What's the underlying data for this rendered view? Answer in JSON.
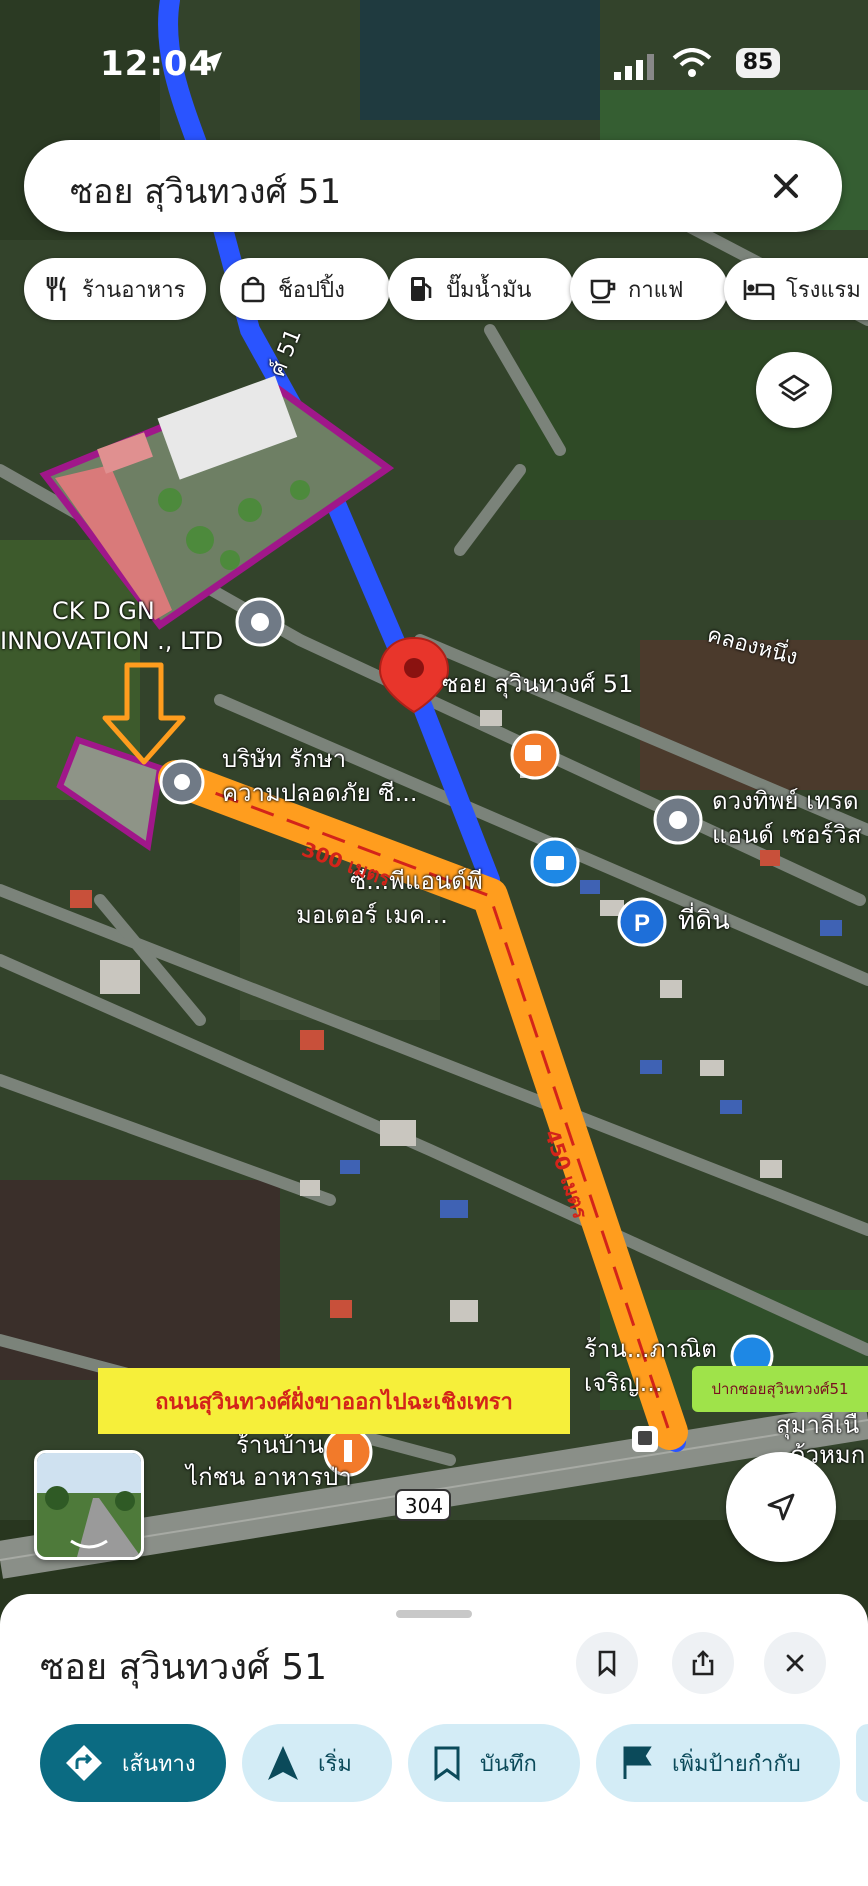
{
  "status_bar": {
    "time": "12:04",
    "battery": "85"
  },
  "search": {
    "query": "ซอย สุวินทวงศ์ 51"
  },
  "categories": [
    {
      "label": "ร้านอาหาร",
      "icon": "fork-knife-icon"
    },
    {
      "label": "ช็อปปิ้ง",
      "icon": "shopping-bag-icon"
    },
    {
      "label": "ปั๊มน้ำมัน",
      "icon": "gas-pump-icon"
    },
    {
      "label": "กาแฟ",
      "icon": "coffee-cup-icon"
    },
    {
      "label": "โรงแรม",
      "icon": "bed-icon"
    }
  ],
  "map": {
    "labels": {
      "road_vertical": "ซอย สุวินทวงศ์ 51",
      "road_51": "ศ์ 51",
      "company_1": "CK D     GN",
      "company_2": "INNOVATION ., LTD",
      "canal": "คลองหนึ่ง",
      "security_1": "บริษัท รักษา",
      "security_2": "ความปลอดภัย ซี...",
      "pp_1": "ซี...พีแอนด์พี",
      "pp_2": "มอเตอร์ เมค...",
      "duangthip_1": "ดวงทิพย์ เทรด",
      "duangthip_2": "แอนด์ เซอร์วิส",
      "land": "ที่ดิน",
      "shop_1": "ร้าน...ภาณิต",
      "shop_2": "เจริญ...",
      "food_1": "ร้านบ้าน",
      "food_2": "ไก่ชน อาหารป่า",
      "right_edge_1": "สุมาลีเนื",
      "right_edge_2": "ด้วหมก",
      "highway": "304"
    },
    "pin_label": "ซอย สุวินทวงศ์ 51",
    "annotations": {
      "distance_1": "300 เมตร",
      "distance_2": "450 เมตร",
      "banner_main": "ถนนสุวินทวงศ์ฝั่งขาออกไปฉะเชิงเทรา",
      "banner_soi": "ปากซอยสุวินทวงศ์51"
    },
    "colors": {
      "route": "#1f4fff",
      "annotation": "#ff9d1e",
      "highlight": "#a0178a"
    }
  },
  "place_sheet": {
    "title": "ซอย สุวินทวงศ์ 51",
    "actions": [
      {
        "label": "เส้นทาง",
        "icon": "directions-icon"
      },
      {
        "label": "เริ่ม",
        "icon": "navigation-arrow-icon"
      },
      {
        "label": "บันทึก",
        "icon": "bookmark-icon"
      },
      {
        "label": "เพิ่มป้ายกำกับ",
        "icon": "flag-icon"
      }
    ]
  }
}
